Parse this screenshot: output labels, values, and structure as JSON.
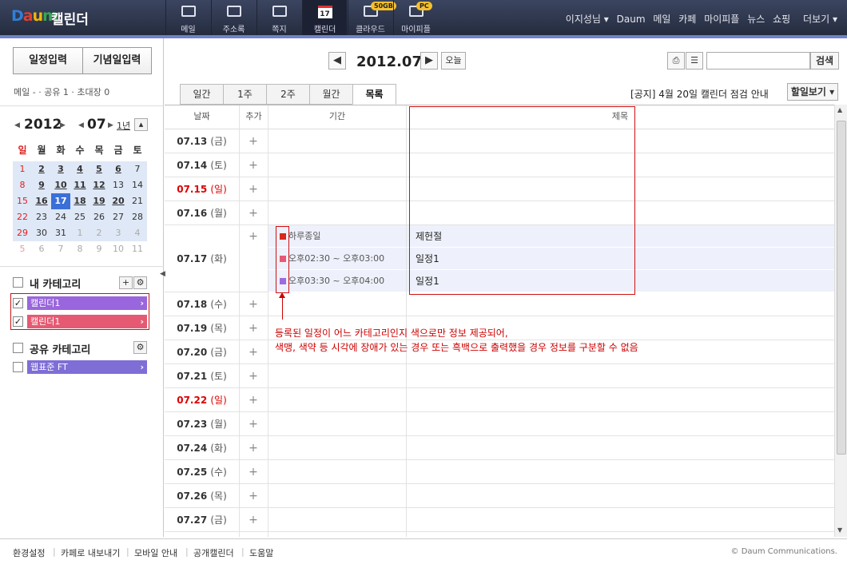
{
  "header": {
    "logo": "DAUM",
    "app_name": "캘린더",
    "nav": [
      {
        "label": "메일",
        "icon": "mail-icon"
      },
      {
        "label": "주소록",
        "icon": "addressbook-icon"
      },
      {
        "label": "쪽지",
        "icon": "note-icon"
      },
      {
        "label": "캘린더",
        "icon": "calendar-icon",
        "icon_text": "17",
        "active": true
      },
      {
        "label": "클라우드",
        "icon": "cloud-icon",
        "badge": "50GB"
      },
      {
        "label": "마이피플",
        "icon": "mypeople-icon",
        "badge": "PC"
      }
    ],
    "user": "이지성님",
    "links": [
      "Daum",
      "메일",
      "카페",
      "마이피플",
      "뉴스",
      "쇼핑",
      "더보기"
    ]
  },
  "sidebar": {
    "add_event": "일정입력",
    "add_anniversary": "기념일입력",
    "counts": "메일 -    · 공유 1  · 초대장 0",
    "year": "2012",
    "month": "07",
    "year_link": "1년",
    "weekdays": [
      "일",
      "월",
      "화",
      "수",
      "목",
      "금",
      "토"
    ],
    "my_category_label": "내 카테고리",
    "my_categories": [
      {
        "name": "캘린더1",
        "color": "#9966dd"
      },
      {
        "name": "캘린더1",
        "color": "#e55a72"
      }
    ],
    "shared_category_label": "공유 카테고리",
    "shared_categories": [
      {
        "name": "웹표준 FT",
        "color": "#7f6ed6"
      }
    ]
  },
  "mini_calendar": [
    [
      "1",
      "2",
      "3",
      "4",
      "5",
      "6",
      "7"
    ],
    [
      "8",
      "9",
      "10",
      "11",
      "12",
      "13",
      "14"
    ],
    [
      "15",
      "16",
      "17",
      "18",
      "19",
      "20",
      "21"
    ],
    [
      "22",
      "23",
      "24",
      "25",
      "26",
      "27",
      "28"
    ],
    [
      "29",
      "30",
      "31",
      "1",
      "2",
      "3",
      "4"
    ],
    [
      "5",
      "6",
      "7",
      "8",
      "9",
      "10",
      "11"
    ]
  ],
  "toolbar": {
    "prev": "◀",
    "next": "▶",
    "period": "2012.07",
    "today": "오늘",
    "search_placeholder": "",
    "search_button": "검색"
  },
  "view_tabs": [
    "일간",
    "1주",
    "2주",
    "월간",
    "목록"
  ],
  "notice": "[공지] 4월 20일 캘린더 점검 안내",
  "todo_button": "할일보기",
  "list_header": {
    "date": "날짜",
    "add": "추가",
    "period": "기간",
    "title": "제목"
  },
  "rows": [
    {
      "date": "07.13",
      "dow": "(금)",
      "holiday": false
    },
    {
      "date": "07.14",
      "dow": "(토)",
      "holiday": false
    },
    {
      "date": "07.15",
      "dow": "(일)",
      "holiday": true
    },
    {
      "date": "07.16",
      "dow": "(월)",
      "holiday": false
    },
    {
      "date": "07.17",
      "dow": "(화)",
      "holiday": false,
      "events": [
        {
          "period": "하루종일",
          "title": "제헌절",
          "color": "#d62a1e"
        },
        {
          "period": "오후02:30 ~ 오후03:00",
          "title": "일정1",
          "color": "#e55a72"
        },
        {
          "period": "오후03:30 ~ 오후04:00",
          "title": "일정1",
          "color": "#9b6be0"
        }
      ]
    },
    {
      "date": "07.18",
      "dow": "(수)",
      "holiday": false
    },
    {
      "date": "07.19",
      "dow": "(목)",
      "holiday": false
    },
    {
      "date": "07.20",
      "dow": "(금)",
      "holiday": false
    },
    {
      "date": "07.21",
      "dow": "(토)",
      "holiday": false
    },
    {
      "date": "07.22",
      "dow": "(일)",
      "holiday": true
    },
    {
      "date": "07.23",
      "dow": "(월)",
      "holiday": false
    },
    {
      "date": "07.24",
      "dow": "(화)",
      "holiday": false
    },
    {
      "date": "07.25",
      "dow": "(수)",
      "holiday": false
    },
    {
      "date": "07.26",
      "dow": "(목)",
      "holiday": false
    },
    {
      "date": "07.27",
      "dow": "(금)",
      "holiday": false
    }
  ],
  "add_symbol": "+",
  "annotation": [
    "등록된 일정이 어느 카테고리인지 색으로만 정보 제공되어,",
    "색맹, 색약 등 시각에 장애가 있는 경우 또는 흑백으로 출력했을 경우 정보를 구분할 수 없음"
  ],
  "footer": {
    "links": [
      "환경설정",
      "카페로 내보내기",
      "모바일 안내",
      "공개캘린더",
      "도움말"
    ],
    "copyright": "© Daum Communications."
  },
  "colors": {
    "topbar": "#2d3449",
    "accent": "#6f82c9",
    "today": "#3a6fd8",
    "holiday": "#dd0000",
    "annotation": "#cc0000"
  }
}
